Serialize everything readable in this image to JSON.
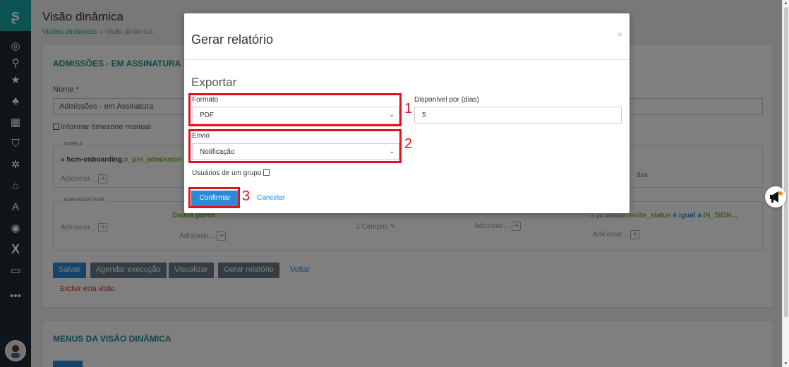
{
  "page": {
    "title": "Visão dinâmica",
    "breadcrumb": [
      "Visões dinâmicas",
      "»",
      "Visão dinâmica"
    ]
  },
  "card": {
    "title": "ADMISSÕES - EM ASSINATURA",
    "nome_label": "Nome",
    "nome_value": "Admissões - em Assinatura",
    "timezone_label": "Informar timezone manual",
    "tabela_legend": "TABELA",
    "tabela_value_prefix": "» hcm-onboarding.",
    "tabela_value_suffix": "v_pre_admission",
    "tabela_add": "Adicionar...",
    "link_right": "das",
    "agrupado_legend": "AGRUPADO POR",
    "agrupado_add": "Adicionar...",
    "dados_puros": "Dados puros",
    "col2_add": "Adicionar...",
    "campos": "3 Campos",
    "col4_add": "Adicionar...",
    "filter_prefix": "» v_pre_admission.",
    "filter_field": "invite_status",
    "filter_op": "é igual a",
    "filter_value": "IN_SIGN...",
    "col5_add": "Adicionar..."
  },
  "actions": {
    "salvar": "Salvar",
    "agendar": "Agendar execução",
    "visualizar": "Visualizar",
    "gerar": "Gerar relatório",
    "voltar": "Voltar",
    "excluir": "Excluir esta visão"
  },
  "card2": {
    "title": "MENUS DA VISÃO DINÂMICA"
  },
  "modal": {
    "title": "Gerar relatório",
    "close": "×",
    "section": "Exportar",
    "formato_label": "Formato",
    "formato_value": "PDF",
    "disponivel_label": "Disponível por (dias)",
    "disponivel_value": "5",
    "envio_label": "Envio",
    "envio_value": "Notificação",
    "usuarios_label": "Usuários de um grupo",
    "confirmar": "Confirmar",
    "cancelar": "Cancelar"
  },
  "annotations": {
    "n1": "1",
    "n2": "2",
    "n3": "3",
    "color": "#e0121f"
  },
  "icons": [
    "logo-icon",
    "user-circle-icon",
    "search-icon",
    "star-icon",
    "sitemap-icon",
    "building-icon",
    "shield-icon",
    "users-icon",
    "lock-icon",
    "font-icon",
    "target-icon",
    "x-icon",
    "monitor-icon",
    "more-icon",
    "megaphone-icon"
  ]
}
